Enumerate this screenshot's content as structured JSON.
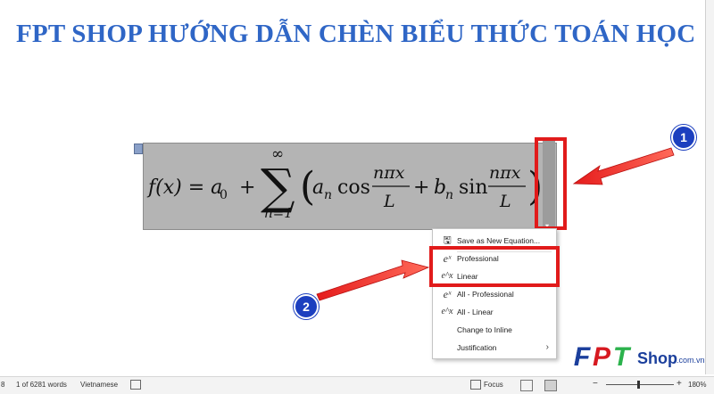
{
  "title": "FPT SHOP HƯỚNG DẪN CHÈN BIỂU THỨC TOÁN HỌC",
  "equation": {
    "lhs": "f(x) = a",
    "sub0": "0",
    "plus1": "+",
    "sum_top": "∞",
    "sum_bottom": "n=1",
    "an": "a",
    "sub_n": "n",
    "cos": "cos",
    "frac_num": "nπx",
    "frac_den": "L",
    "plus2": "+",
    "bn": "b",
    "sin": "sin",
    "handle_arrow": "▾"
  },
  "menu": {
    "items": [
      {
        "label": "Save as New Equation...",
        "icon": "save-icon",
        "glyph": "🖫"
      },
      {
        "label": "Professional",
        "icon": "professional-icon",
        "glyph": "eˣ"
      },
      {
        "label": "Linear",
        "icon": "linear-icon",
        "glyph": "e^x"
      },
      {
        "label": "All - Professional",
        "icon": "all-professional-icon",
        "glyph": "eˣ"
      },
      {
        "label": "All - Linear",
        "icon": "all-linear-icon",
        "glyph": "e^x"
      },
      {
        "label": "Change to Inline",
        "icon": "",
        "glyph": ""
      },
      {
        "label": "Justification",
        "icon": "",
        "glyph": "",
        "arrow": "›"
      }
    ]
  },
  "badges": {
    "one": "1",
    "two": "2"
  },
  "status": {
    "page": "8",
    "words": "1 of 6281 words",
    "language": "Vietnamese",
    "focus": "Focus",
    "zoom": "180%",
    "zoom_minus": "−",
    "zoom_plus": "+"
  },
  "logo": {
    "f": "F",
    "p": "P",
    "t": "T",
    "shop": "Shop",
    "domain": ".com.vn"
  },
  "colors": {
    "title": "#2f66c6",
    "highlight": "#e11b1b",
    "badge": "#1c3fbf",
    "logo_red": "#d71920",
    "logo_blue": "#1b3f9c",
    "logo_green": "#2bb24c"
  }
}
